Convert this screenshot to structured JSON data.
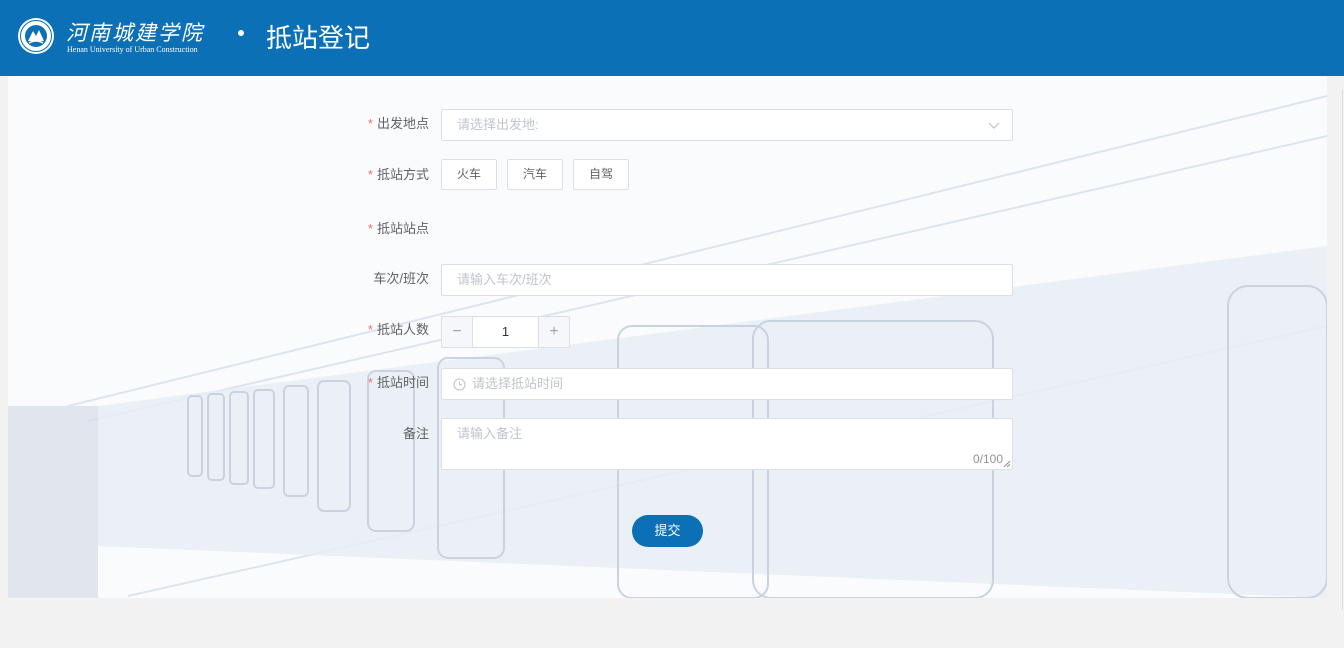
{
  "header": {
    "logo_cn": "河南城建学院",
    "logo_en": "Henan University of Urban Construction",
    "separator": "•",
    "title": "抵站登记"
  },
  "form": {
    "required_mark": "*",
    "departure": {
      "label": "出发地点",
      "placeholder": "请选择出发地:"
    },
    "method": {
      "label": "抵站方式",
      "options": [
        "火车",
        "汽车",
        "自驾"
      ]
    },
    "station": {
      "label": "抵站站点"
    },
    "train_no": {
      "label": "车次/班次",
      "placeholder": "请输入车次/班次"
    },
    "people": {
      "label": "抵站人数",
      "value": "1",
      "minus": "−",
      "plus": "+"
    },
    "time": {
      "label": "抵站时间",
      "placeholder": "请选择抵站时间"
    },
    "remark": {
      "label": "备注",
      "placeholder": "请输入备注",
      "counter": "0/100"
    },
    "submit_label": "提交"
  },
  "colors": {
    "brand": "#0b70b6",
    "required": "#f56c6c",
    "border": "#dcdfe6",
    "placeholder": "#c0c4cc"
  },
  "icons": [
    "university-seal",
    "chevron-down-icon",
    "clock-icon",
    "resize-handle-icon"
  ]
}
